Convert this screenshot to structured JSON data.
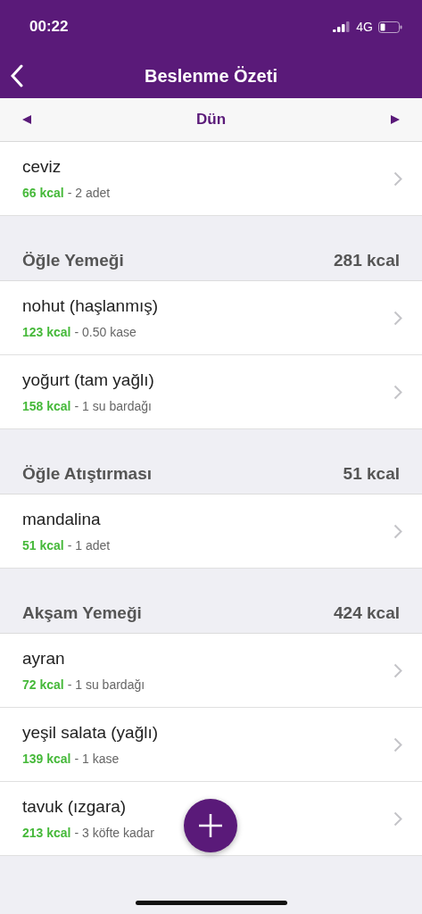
{
  "status_bar": {
    "time": "00:22",
    "network": "4G"
  },
  "nav_bar": {
    "title": "Beslenme Özeti"
  },
  "date_nav": {
    "label": "Dün"
  },
  "sections": [
    {
      "items": [
        {
          "name": "ceviz",
          "kcal": "66 kcal",
          "portion": "- 2 adet"
        }
      ]
    },
    {
      "title": "Öğle Yemeği",
      "total": "281 kcal",
      "items": [
        {
          "name": "nohut (haşlanmış)",
          "kcal": "123 kcal",
          "portion": "- 0.50 kase"
        },
        {
          "name": "yoğurt (tam yağlı)",
          "kcal": "158 kcal",
          "portion": "- 1 su bardağı"
        }
      ]
    },
    {
      "title": "Öğle Atıştırması",
      "total": "51 kcal",
      "items": [
        {
          "name": "mandalina",
          "kcal": "51 kcal",
          "portion": "- 1 adet"
        }
      ]
    },
    {
      "title": "Akşam Yemeği",
      "total": "424 kcal",
      "items": [
        {
          "name": "ayran",
          "kcal": "72 kcal",
          "portion": "- 1 su bardağı"
        },
        {
          "name": "yeşil salata (yağlı)",
          "kcal": "139 kcal",
          "portion": "- 1 kase"
        },
        {
          "name": "tavuk (ızgara)",
          "kcal": "213 kcal",
          "portion": "- 3 köfte kadar"
        }
      ]
    }
  ]
}
